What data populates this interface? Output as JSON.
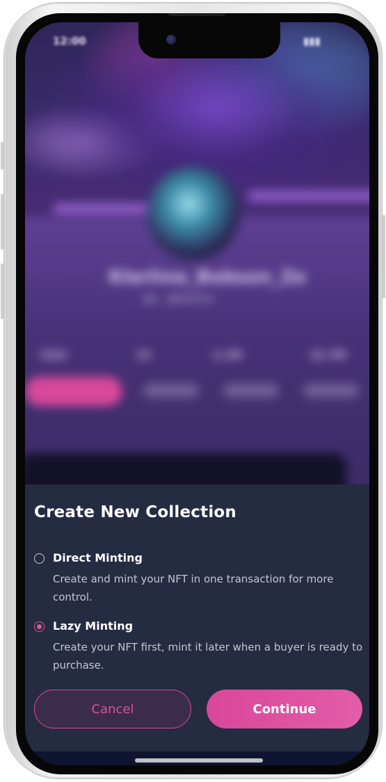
{
  "status_bar": {
    "time": "12:00",
    "signal": "▮▮▮"
  },
  "background_profile": {
    "name": "Klarline_Bobson_Ze",
    "handle": "@c...@klarline",
    "stats": [
      "1521",
      "23",
      "2.1M",
      "22.7M"
    ],
    "tabs": [
      "Collected",
      "Activity",
      "History",
      "Created"
    ],
    "active_tab": "Collected"
  },
  "sheet": {
    "title": "Create New Collection",
    "options": [
      {
        "label": "Direct Minting",
        "description": "Create and mint your NFT in one transaction for more control.",
        "selected": false
      },
      {
        "label": "Lazy Minting",
        "description": "Create your NFT first, mint it later when a buyer is ready to purchase.",
        "selected": true
      }
    ],
    "cancel_label": "Cancel",
    "continue_label": "Continue"
  },
  "colors": {
    "accent": "#e5519c",
    "sheet_bg": "#252b41",
    "cancel_bg": "#3b2c4c"
  }
}
